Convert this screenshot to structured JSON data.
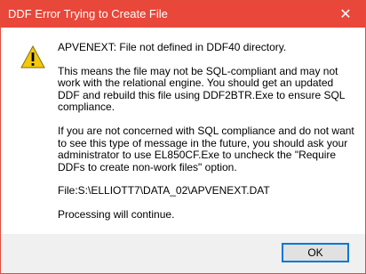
{
  "window": {
    "title": "DDF Error Trying to Create File",
    "close_symbol": "✕"
  },
  "message": {
    "line1": "APVENEXT: File not defined in DDF40 directory.",
    "para2": "This means the file may not be SQL-compliant and may not work with the relational engine.  You should get an updated DDF and rebuild this file using DDF2BTR.Exe to ensure SQL compliance.",
    "para3": "If you are not concerned with SQL compliance and do not want to see this type of message in the future, you should ask your administrator to use EL850CF.Exe to uncheck the \"Require DDFs to create non-work files\" option.",
    "file_line": "File:S:\\ELLIOTT7\\DATA_02\\APVENEXT.DAT",
    "processing": "Processing will continue."
  },
  "buttons": {
    "ok_label": "OK"
  },
  "icons": {
    "warning": "warning-icon",
    "close": "close-icon"
  },
  "colors": {
    "titlebar": "#e8473a",
    "accent": "#0078d7",
    "warning_yellow": "#f2c811"
  }
}
